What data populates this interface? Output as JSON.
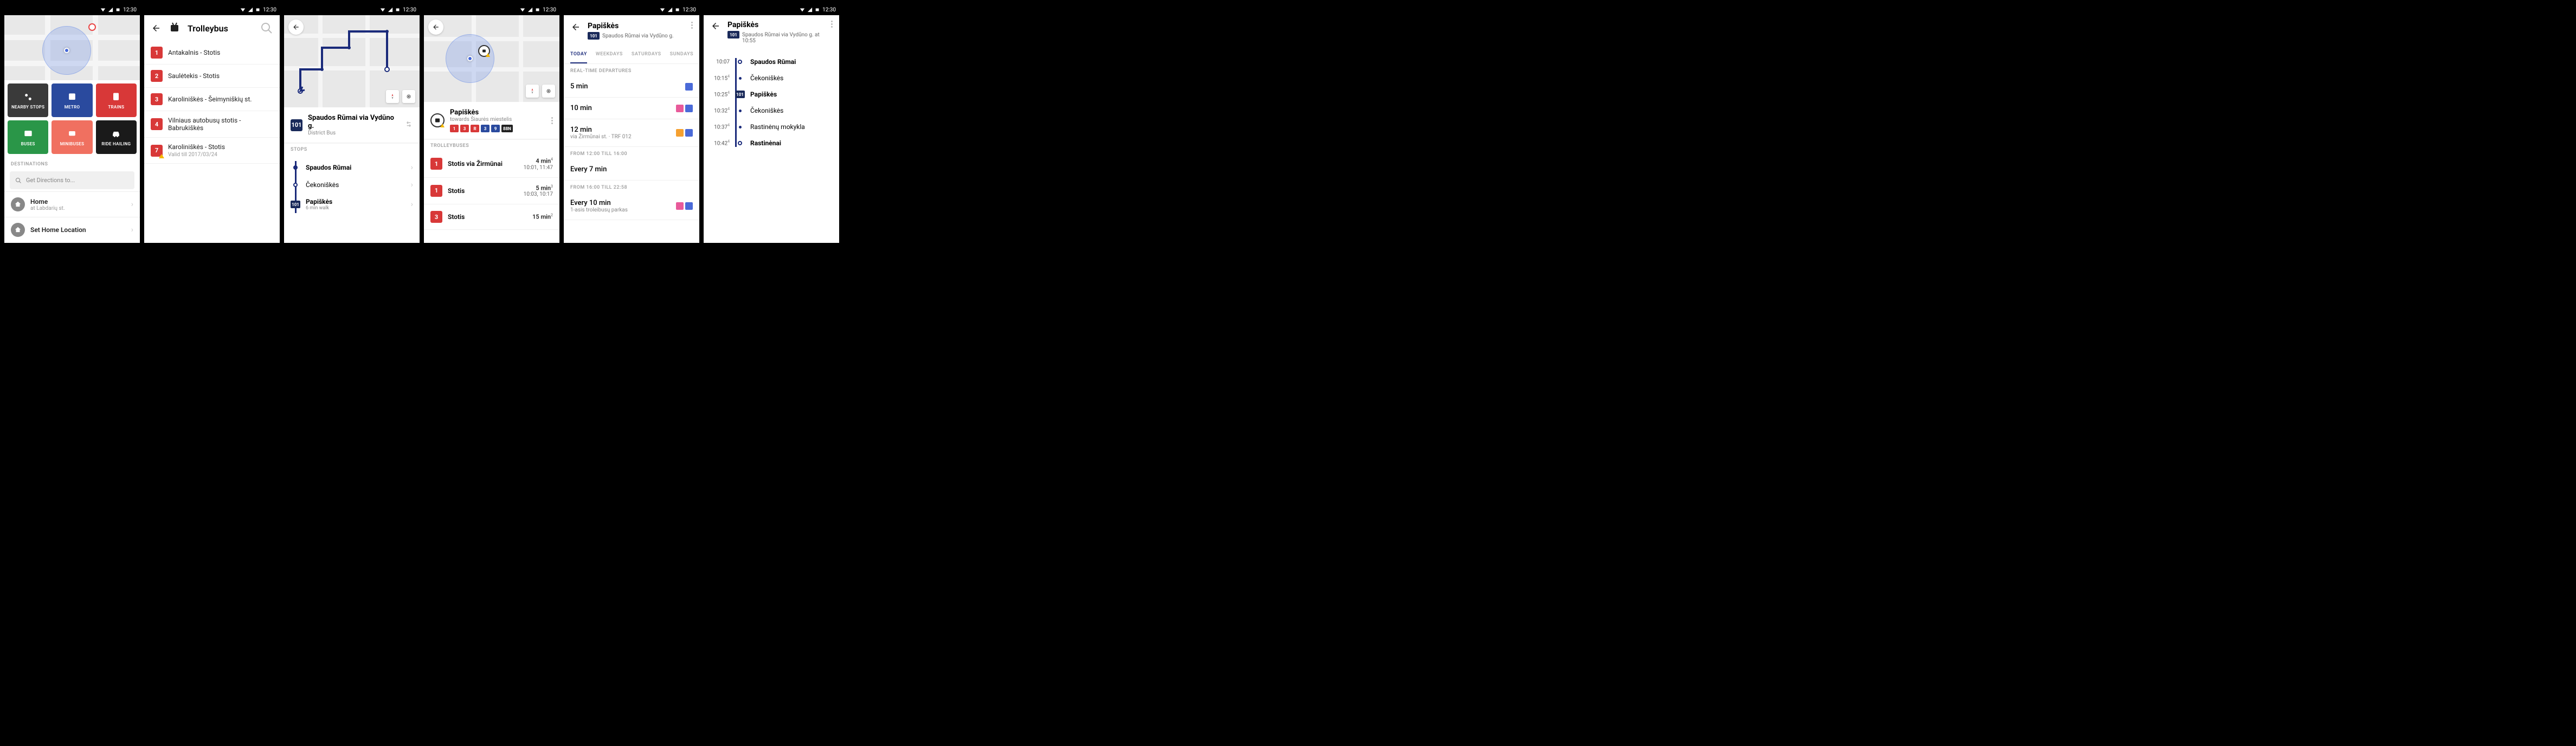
{
  "status_time": "12:30",
  "s1": {
    "tiles": [
      {
        "label": "NEARBY STOPS"
      },
      {
        "label": "METRO"
      },
      {
        "label": "TRAINS"
      },
      {
        "label": "BUSES"
      },
      {
        "label": "MINIBUSES"
      },
      {
        "label": "RIDE HAILING"
      }
    ],
    "destinations_label": "DESTINATIONS",
    "search_placeholder": "Get Directions to...",
    "home_label": "Home",
    "home_sub": "at Labdarių st.",
    "set_home": "Set Home Location"
  },
  "s2": {
    "title": "Trolleybus",
    "routes": [
      {
        "num": "1",
        "name": "Antakalnis - Stotis"
      },
      {
        "num": "2",
        "name": "Saulėtekis - Stotis"
      },
      {
        "num": "3",
        "name": "Karoliniškės - Šeimyniškių st."
      },
      {
        "num": "4",
        "name": "Vilniaus autobusų stotis - Babrukiškės"
      },
      {
        "num": "7",
        "name": "Karoliniškės - Stotis",
        "sub": "Valid till 2017/03/24",
        "warn": true
      }
    ]
  },
  "s3": {
    "route_num": "101",
    "route_title": "Spaudos Rūmai via Vydūno g.",
    "route_sub": "District Bus",
    "stops_label": "STOPS",
    "stops": [
      {
        "name": "Spaudos Rūmai",
        "bold": true,
        "type": "start"
      },
      {
        "name": "Čekoniškės",
        "type": "mid"
      },
      {
        "name": "Papiškės",
        "sub": "6 min walk",
        "bold": true,
        "type": "current",
        "badge": "101"
      }
    ]
  },
  "s4": {
    "stop_title": "Papiškės",
    "stop_sub": "towards Šiaurės miestelis",
    "badges": [
      "1",
      "3",
      "R",
      "3",
      "9",
      "88N"
    ],
    "section": "TROLLEYBUSES",
    "rows": [
      {
        "num": "1",
        "name": "Stotis via Žirmūnai",
        "mins": "4 min",
        "sup": "4",
        "times": "10:01, 11:47"
      },
      {
        "num": "1",
        "name": "Stotis",
        "mins": "5 min",
        "sup": "3",
        "times": "10:03, 10:17"
      },
      {
        "num": "3",
        "name": "Stotis",
        "mins": "15 min",
        "sup": "2",
        "times": ""
      }
    ]
  },
  "s5": {
    "title": "Papiškės",
    "badge": "101",
    "sub": "Spaudos Rūmai via Vydūno g.",
    "tabs": [
      "TODAY",
      "WEEKDAYS",
      "SATURDAYS",
      "SUNDAYS"
    ],
    "realtime_label": "REAL-TIME DEPARTURES",
    "realtime": [
      {
        "t": "5 min",
        "icons": [
          "blue"
        ]
      },
      {
        "t": "10 min",
        "icons": [
          "pink",
          "blue"
        ]
      },
      {
        "t": "12 min",
        "sub": "via Žirmūnai st. · TRF 012",
        "icons": [
          "orange",
          "blue"
        ]
      }
    ],
    "sched": [
      {
        "header": "FROM 12:00 TILL 16:00",
        "t": "Every 7 min"
      },
      {
        "header": "FROM 16:00 TILL 22:58",
        "t": "Every 10 min",
        "sub": "1-asis troleibusų parkas",
        "icons": [
          "pink",
          "blue"
        ]
      }
    ]
  },
  "s6": {
    "title": "Papiškės",
    "badge": "101",
    "sub": "Spaudos Rūmai via Vydūno g. at 10:55",
    "stops": [
      {
        "t": "10:07",
        "name": "Spaudos Rūmai",
        "bold": true,
        "type": "end"
      },
      {
        "t": "10:15",
        "sup": "4",
        "name": "Čekoniškės",
        "type": "mid"
      },
      {
        "t": "10:25",
        "sup": "4",
        "name": "Papiškės",
        "bold": true,
        "type": "current",
        "badge": "101"
      },
      {
        "t": "10:32",
        "sup": "4",
        "name": "Čekoniškės",
        "type": "mid"
      },
      {
        "t": "10:37",
        "sup": "4",
        "name": "Rastinėnų mokykla",
        "type": "mid"
      },
      {
        "t": "10:42",
        "sup": "4",
        "name": "Rastinėnai",
        "bold": true,
        "type": "end"
      }
    ]
  }
}
